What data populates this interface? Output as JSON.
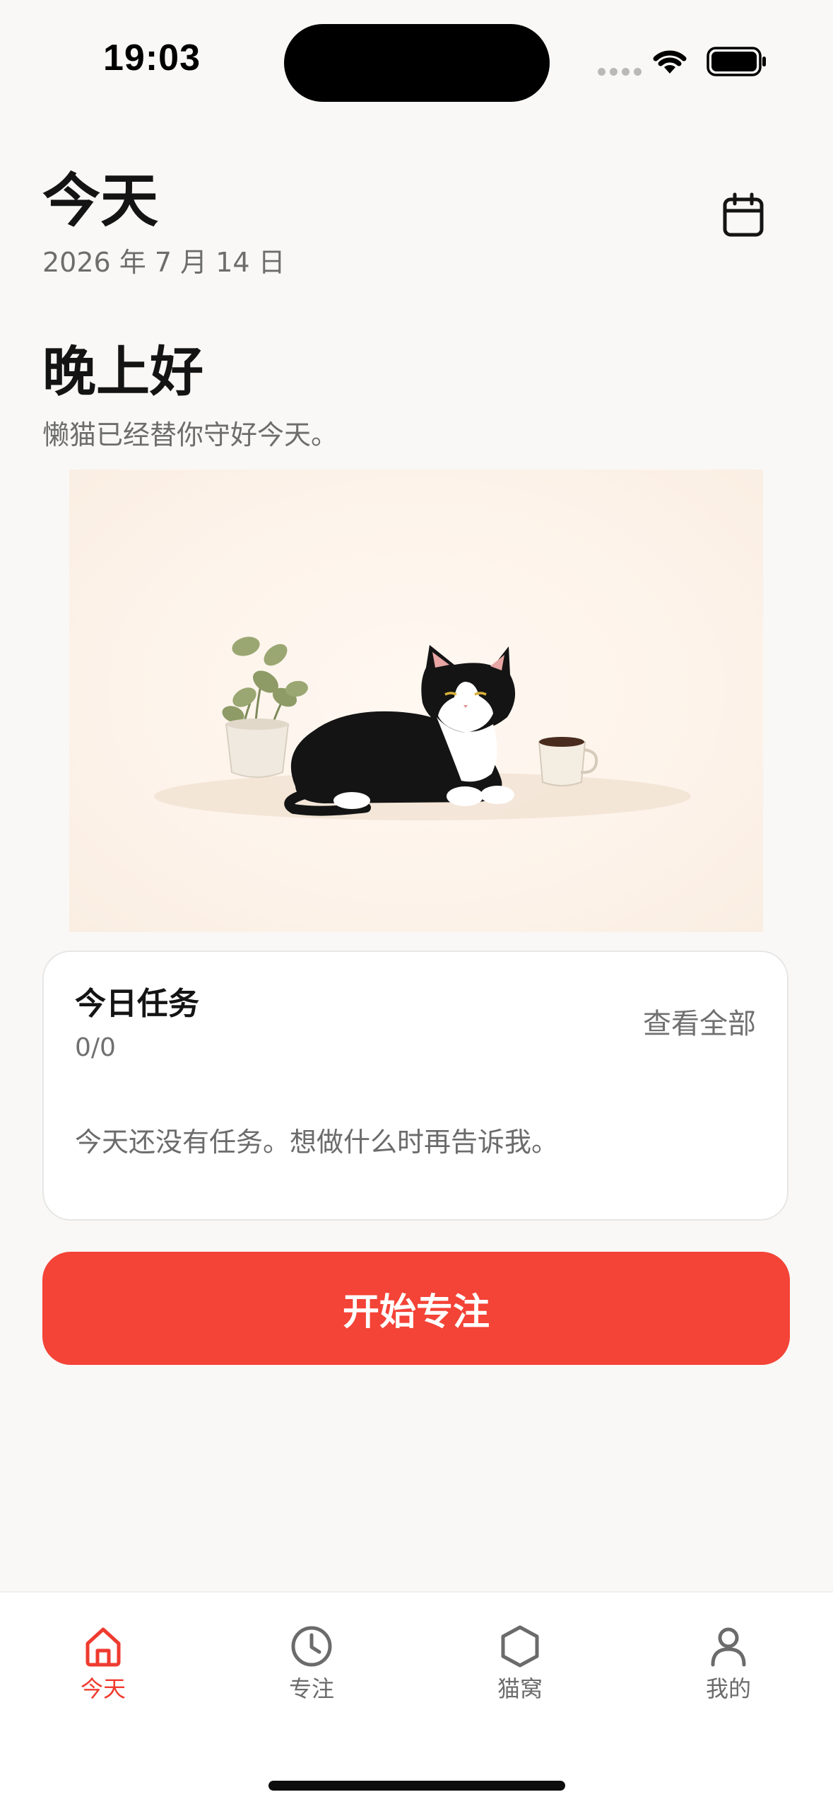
{
  "status_bar": {
    "time": "19:03"
  },
  "header": {
    "title": "今天",
    "date": "2026 年 7 月 14 日",
    "calendar_icon": "calendar-icon"
  },
  "greeting": {
    "title": "晚上好",
    "subtitle": "懒猫已经替你守好今天。"
  },
  "illustration": {
    "description_icon": "cat-illustration"
  },
  "task_card": {
    "title": "今日任务",
    "count": "0/0",
    "view_all": "查看全部",
    "empty_text": "今天还没有任务。想做什么时再告诉我。"
  },
  "primary_button": {
    "label": "开始专注"
  },
  "tab_bar": {
    "active_color": "#ef3b2f",
    "inactive_color": "#6b6b6b",
    "items": [
      {
        "label": "今天",
        "icon": "home-icon",
        "active": true
      },
      {
        "label": "专注",
        "icon": "clock-icon",
        "active": false
      },
      {
        "label": "猫窝",
        "icon": "hexagon-icon",
        "active": false
      },
      {
        "label": "我的",
        "icon": "user-icon",
        "active": false
      }
    ]
  },
  "colors": {
    "background": "#f9f8f6",
    "accent": "#f44337"
  }
}
